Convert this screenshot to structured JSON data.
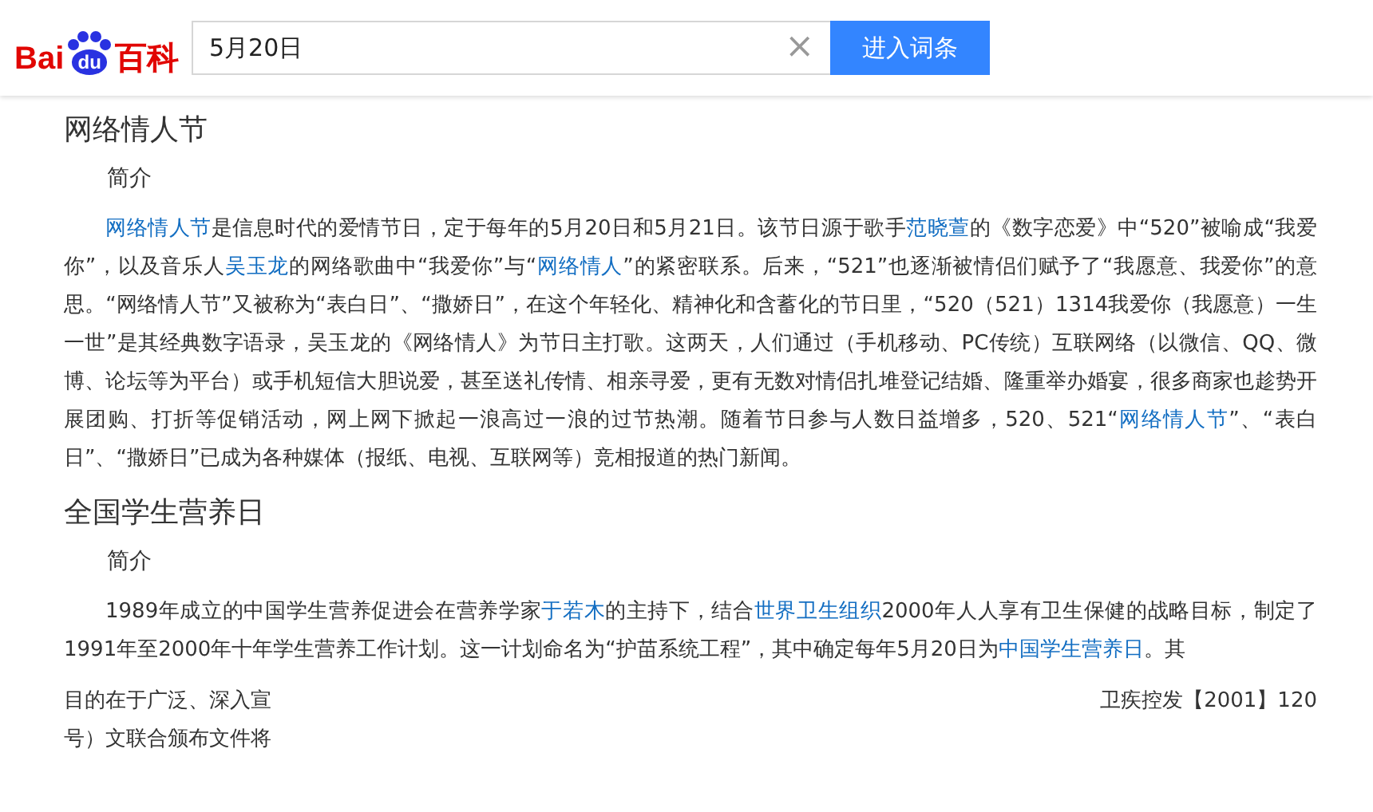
{
  "header": {
    "logo": {
      "left": "Bai",
      "paw": "du",
      "right": "百科"
    },
    "search": {
      "value": "5月20日",
      "clear": "×"
    },
    "button": "进入词条"
  },
  "sections": [
    {
      "title": "网络情人节",
      "subtitle": "简介",
      "paragraphs": [
        [
          {
            "text": "网络情人节",
            "link": true
          },
          {
            "text": "是信息时代的爱情节日，定于每年的5月20日和5月21日。该节日源于歌手",
            "link": false
          },
          {
            "text": "范晓萱",
            "link": true
          },
          {
            "text": "的《数字恋爱》中“520”被喻成“我爱你”，以及音乐人",
            "link": false
          },
          {
            "text": "吴玉龙",
            "link": true
          },
          {
            "text": "的网络歌曲中“我爱你”与“",
            "link": false
          },
          {
            "text": "网络情人",
            "link": true
          },
          {
            "text": "”的紧密联系。后来，“521”也逐渐被情侣们赋予了“我愿意、我爱你”的意思。“网络情人节”又被称为“表白日”、“撒娇日”，在这个年轻化、精神化和含蓄化的节日里，“520（521）1314我爱你（我愿意）一生一世”是其经典数字语录，吴玉龙的《网络情人》为节日主打歌。这两天，人们通过（手机移动、PC传统）互联网络（以微信、QQ、微博、论坛等为平台）或手机短信大胆说爱，甚至送礼传情、相亲寻爱，更有无数对情侣扎堆登记结婚、隆重举办婚宴，很多商家也趁势开展团购、打折等促销活动，网上网下掀起一浪高过一浪的过节热潮。随着节日参与人数日益增多，520、521“",
            "link": false
          },
          {
            "text": "网络情人节",
            "link": true
          },
          {
            "text": "”、“表白日”、“撒娇日”已成为各种媒体（报纸、电视、互联网等）竞相报道的热门新闻。",
            "link": false
          }
        ]
      ]
    },
    {
      "title": "全国学生营养日",
      "subtitle": "简介",
      "paragraphs": [
        [
          {
            "text": "1989年成立的中国学生营养促进会在营养学家",
            "link": false
          },
          {
            "text": "于若木",
            "link": true
          },
          {
            "text": "的主持下，结合",
            "link": false
          },
          {
            "text": "世界卫生组织",
            "link": true
          },
          {
            "text": "2000年人人享有卫生保健的战略目标，制定了1991年至2000年十年学生营养工作计划。这一计划命名为“护苗系统工程”，其中确定每年5月20日为",
            "link": false
          },
          {
            "text": "中国学生营养日",
            "link": true
          },
          {
            "text": "。其",
            "link": false
          }
        ]
      ],
      "fragments": [
        {
          "left": "目的在于广泛、深入宣",
          "right": "卫疾控发【2001】120"
        },
        {
          "left": "号）文联合颁布文件将"
        }
      ]
    }
  ]
}
